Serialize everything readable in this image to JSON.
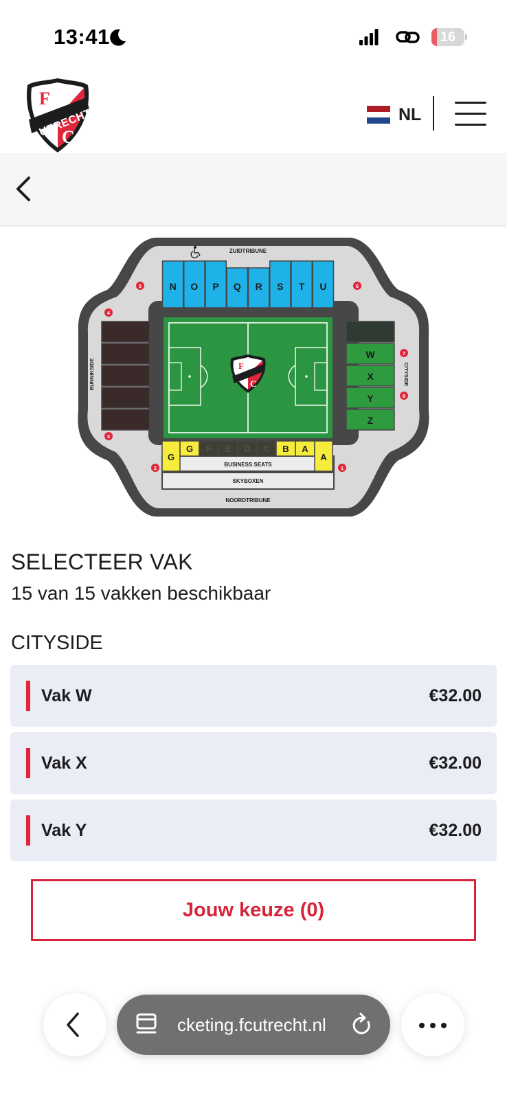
{
  "status_bar": {
    "time": "13:41",
    "battery_level": "16",
    "battery_fraction": 0.16,
    "icons": [
      "moon-icon",
      "signal-icon",
      "link-icon",
      "battery-icon"
    ]
  },
  "header": {
    "logo": {
      "name": "fc-utrecht-logo",
      "letters": [
        "F",
        "UTRECHT",
        "C"
      ]
    },
    "language": "NL",
    "flag_colors": [
      "#ae1c28",
      "#ffffff",
      "#21468b"
    ],
    "menu_icon": "hamburger-menu-icon"
  },
  "back_bar": {
    "icon": "chevron-left-icon"
  },
  "stadium": {
    "stands": {
      "south": "ZUIDTRIBUNE",
      "north": "NOORDTRIBUNE",
      "west": "BUNNIKSIDE",
      "east": "CITYSIDE"
    },
    "south_sections": [
      "N",
      "O",
      "P",
      "Q",
      "R",
      "S",
      "T",
      "U"
    ],
    "north_sections": [
      "G",
      "G",
      "F",
      "E",
      "D",
      "C",
      "B",
      "A",
      "A"
    ],
    "north_section_available": [
      true,
      true,
      false,
      false,
      false,
      false,
      true,
      true,
      true
    ],
    "east_sections": [
      "",
      "W",
      "X",
      "Y",
      "Z"
    ],
    "east_section_available": [
      false,
      true,
      true,
      true,
      true
    ],
    "business_label": "BUSINESS SEATS",
    "skybox_label": "SKYBOXEN",
    "entrances": [
      "1",
      "2",
      "3",
      "4",
      "5",
      "6",
      "7",
      "8"
    ],
    "wheelchair_icon": "wheelchair-icon",
    "colors": {
      "south": "#1fb2e8",
      "north": "#f7ec3b",
      "east": "#2e9b3e",
      "west": "#3a2a2a",
      "pitch": "#2b9542",
      "ring": "#464646",
      "concourse": "#d9d9d9",
      "entrance": "#e0263a"
    }
  },
  "content": {
    "title": "SELECTEER VAK",
    "availability": "15 van 15 vakken beschikbaar",
    "section_title": "CITYSIDE",
    "vakken": [
      {
        "label": "Vak W",
        "price": "€32.00"
      },
      {
        "label": "Vak X",
        "price": "€32.00"
      },
      {
        "label": "Vak Y",
        "price": "€32.00"
      }
    ],
    "choice_button": "Jouw keuze (0)",
    "accent_color": "#e0263a"
  },
  "browser": {
    "url": "cketing.fcutrecht.nl",
    "icons": [
      "chevron-left-icon",
      "tabs-icon",
      "reload-icon",
      "more-icon"
    ]
  }
}
